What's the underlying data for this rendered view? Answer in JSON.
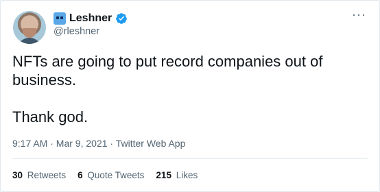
{
  "author": {
    "display_name": "Leshner",
    "handle": "@rleshner",
    "name_emoji": "robot-face-icon",
    "verified_icon": "verified-badge-icon"
  },
  "tweet": {
    "text": "NFTs are going to put record companies out of\nbusiness.\n\nThank god.",
    "meta": "9:17 AM · Mar 9, 2021 · Twitter Web App"
  },
  "stats": {
    "retweets_count": "30",
    "retweets_label": "Retweets",
    "quotes_count": "6",
    "quotes_label": "Quote Tweets",
    "likes_count": "215",
    "likes_label": "Likes"
  },
  "menu": {
    "more_icon": "more-options-icon"
  },
  "colors": {
    "accent": "#1d9bf0",
    "text": "#0f1419",
    "muted": "#536471"
  }
}
